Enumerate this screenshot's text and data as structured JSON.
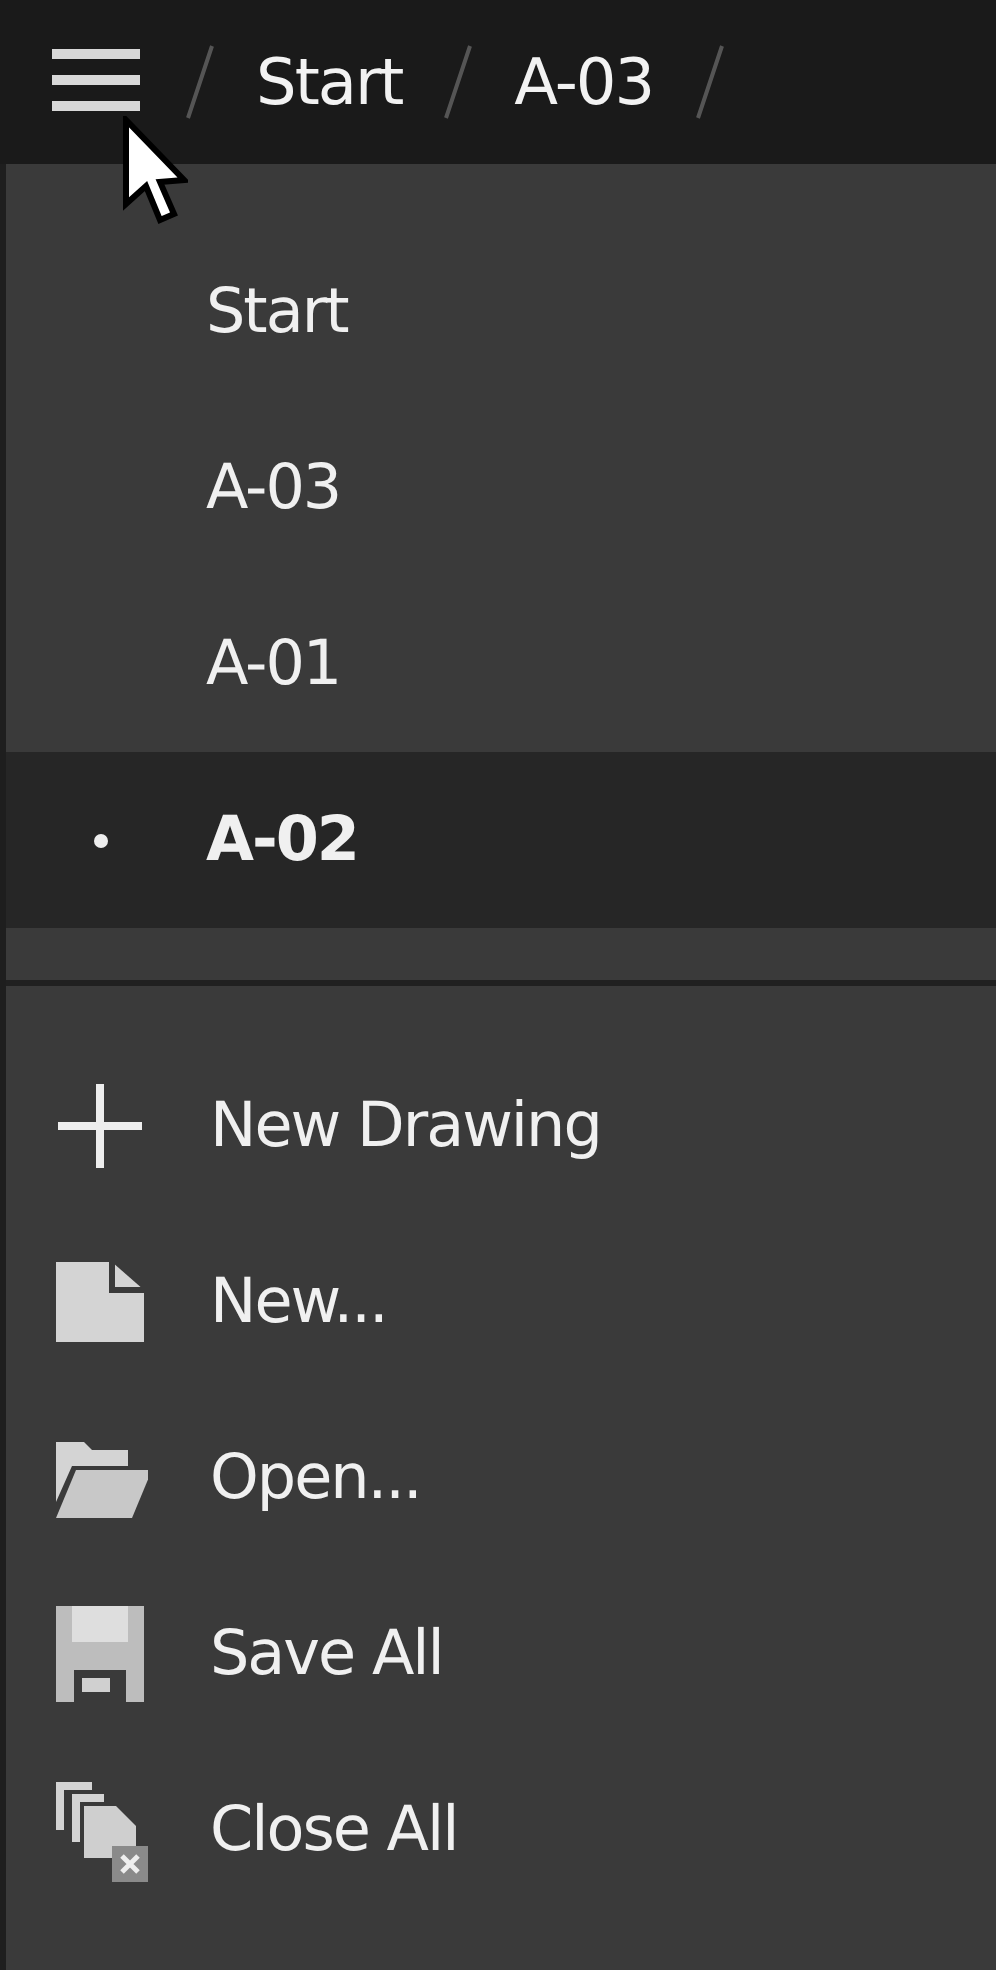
{
  "breadcrumb": [
    {
      "label": "Start"
    },
    {
      "label": "A-03"
    }
  ],
  "drawings": [
    {
      "label": "Start",
      "selected": false
    },
    {
      "label": "A-03",
      "selected": false
    },
    {
      "label": "A-01",
      "selected": false
    },
    {
      "label": "A-02",
      "selected": true
    }
  ],
  "actions": [
    {
      "label": "New Drawing",
      "kind": "plus"
    },
    {
      "label": "New...",
      "kind": "new"
    },
    {
      "label": "Open...",
      "kind": "open"
    },
    {
      "label": "Save All",
      "kind": "save"
    },
    {
      "label": "Close All",
      "kind": "close"
    }
  ]
}
